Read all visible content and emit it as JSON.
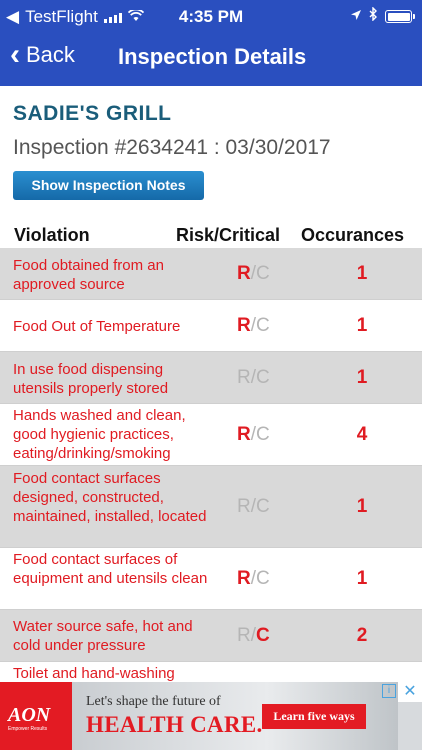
{
  "status_bar": {
    "carrier": "TestFlight",
    "time": "4:35 PM"
  },
  "nav": {
    "back_label": "Back",
    "title": "Inspection Details"
  },
  "header": {
    "restaurant": "SADIE'S GRILL",
    "inspection_line": "Inspection #2634241  :  03/30/2017",
    "notes_button": "Show Inspection Notes"
  },
  "table": {
    "columns": [
      "Violation",
      "Risk/Critical",
      "Occurances"
    ],
    "rows": [
      {
        "violation": "Food obtained from an approved source",
        "r": "R",
        "slash": "/",
        "c": "C",
        "risk_active": true,
        "critical_active": false,
        "occurrences": "1"
      },
      {
        "violation": "Food Out of Temperature",
        "r": "R",
        "slash": "/",
        "c": "C",
        "risk_active": true,
        "critical_active": false,
        "occurrences": "1"
      },
      {
        "violation": "In use food dispensing utensils properly stored",
        "r": "R",
        "slash": "/",
        "c": "C",
        "risk_active": false,
        "critical_active": false,
        "occurrences": "1"
      },
      {
        "violation": "Hands washed and clean, good hygienic practices, eating/drinking/smoking",
        "r": "R",
        "slash": "/",
        "c": "C",
        "risk_active": true,
        "critical_active": false,
        "occurrences": "4"
      },
      {
        "violation": "Food contact surfaces designed, constructed, maintained, installed, located",
        "r": "R",
        "slash": "/",
        "c": "C",
        "risk_active": false,
        "critical_active": false,
        "occurrences": "1"
      },
      {
        "violation": "Food contact surfaces of equipment and utensils clean",
        "r": "R",
        "slash": "/",
        "c": "C",
        "risk_active": true,
        "critical_active": false,
        "occurrences": "1"
      },
      {
        "violation": "Water source safe, hot and cold under pressure",
        "r": "R",
        "slash": "/",
        "c": "C",
        "risk_active": false,
        "critical_active": true,
        "occurrences": "2"
      },
      {
        "violation": "Toilet and hand-washing",
        "r": "",
        "slash": "",
        "c": "",
        "risk_active": false,
        "critical_active": false,
        "occurrences": ""
      }
    ]
  },
  "ad": {
    "brand": "AON",
    "brand_sub": "Empower Results",
    "line1": "Let's shape the future of",
    "line2": "HEALTH CARE.",
    "cta": "Learn five ways",
    "info": "i",
    "close": "✕"
  },
  "colors": {
    "nav_bar": "#2a4fbf",
    "violation_red": "#e01b22",
    "row_gray": "#d9d9d9",
    "restaurant_teal": "#1a5d7a"
  }
}
